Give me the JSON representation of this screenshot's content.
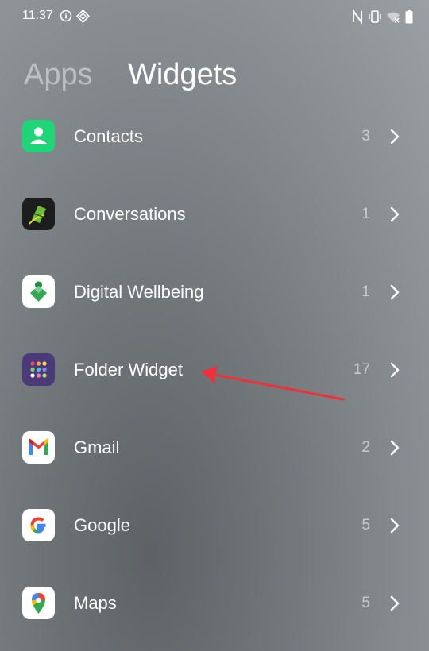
{
  "status_bar": {
    "time": "11:37",
    "icons": [
      "info-icon",
      "settings-diamond-icon",
      "nfc-icon",
      "vibrate-icon",
      "wifi-off-icon",
      "battery-icon"
    ]
  },
  "tabs": [
    {
      "label": "Apps",
      "active": false
    },
    {
      "label": "Widgets",
      "active": true
    }
  ],
  "apps": [
    {
      "name": "Contacts",
      "count": "3",
      "icon": "contacts-icon",
      "color": "#1ed578"
    },
    {
      "name": "Conversations",
      "count": "1",
      "icon": "conversations-icon",
      "color": "#1d1d1d"
    },
    {
      "name": "Digital Wellbeing",
      "count": "1",
      "icon": "digital-wellbeing-icon",
      "color": "#ffffff"
    },
    {
      "name": "Folder Widget",
      "count": "17",
      "icon": "folder-widget-icon",
      "color": "#4a3b78"
    },
    {
      "name": "Gmail",
      "count": "2",
      "icon": "gmail-icon",
      "color": "#ffffff"
    },
    {
      "name": "Google",
      "count": "5",
      "icon": "google-icon",
      "color": "#ffffff"
    },
    {
      "name": "Maps",
      "count": "5",
      "icon": "maps-icon",
      "color": "#ffffff"
    }
  ],
  "annotation": {
    "color": "#f0303a",
    "target": "Folder Widget"
  }
}
